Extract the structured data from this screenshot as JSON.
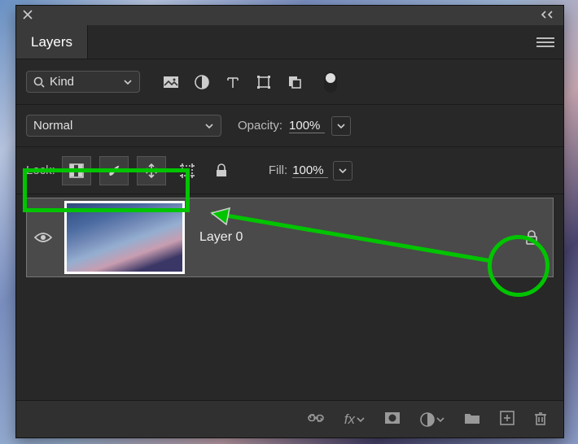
{
  "panel": {
    "tab_label": "Layers"
  },
  "filter_row": {
    "kind_label": "Kind"
  },
  "blend_row": {
    "mode": "Normal",
    "opacity_label": "Opacity:",
    "opacity_value": "100%"
  },
  "lock_row": {
    "lock_label": "Lock:",
    "fill_label": "Fill:",
    "fill_value": "100%"
  },
  "layer": {
    "name": "Layer 0"
  },
  "footer": {
    "fx_label": "fx"
  }
}
